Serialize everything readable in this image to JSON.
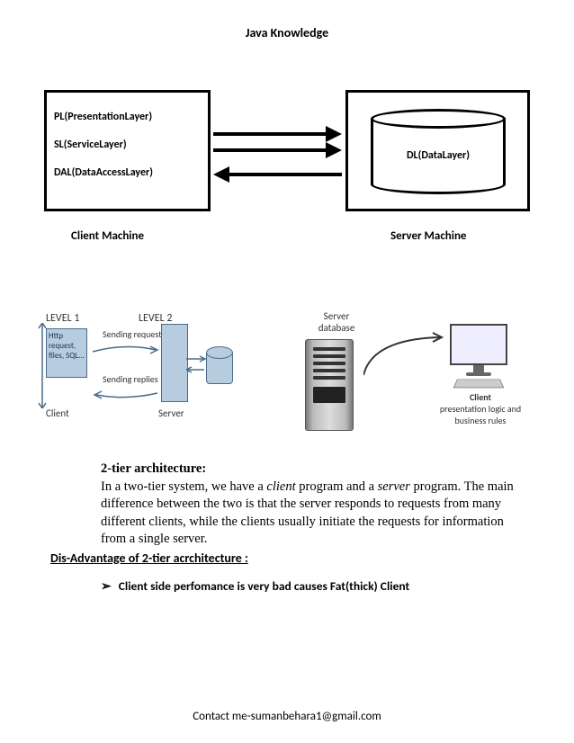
{
  "header": {
    "title": "Java Knowledge"
  },
  "footer": {
    "contact": "Contact me-sumanbehara1@gmail.com"
  },
  "diagram1": {
    "client_lines": {
      "pl": "PL(PresentationLayer)",
      "sl": "SL(ServiceLayer)",
      "dal": "DAL(DataAccessLayer)"
    },
    "server_label": "DL(DataLayer)",
    "client_caption": "Client Machine",
    "server_caption": "Server Machine"
  },
  "diagram2": {
    "level1": "LEVEL 1",
    "level2": "LEVEL 2",
    "httpbox": "Http request, files, SQL...",
    "sending_requests": "Sending requests",
    "sending_replies": "Sending replies",
    "client": "Client",
    "server": "Server",
    "server_db": "Server database",
    "client_right": "Client",
    "client_caption": "presentation logic and business rules"
  },
  "body": {
    "title": "2-tier architecture:",
    "p1a": "In a two-tier system, we have a ",
    "p1b": "client",
    "p1c": " program and a ",
    "p1d": "server",
    "p1e": " program. The main difference between the two is that the server responds to requests from many different clients, while the clients usually initiate the requests for information from a single server.",
    "disadv_title": "Dis-Advantage of 2-tier acrchitecture :",
    "bullet1": "Client side perfomance is very bad causes Fat(thick) Client"
  }
}
